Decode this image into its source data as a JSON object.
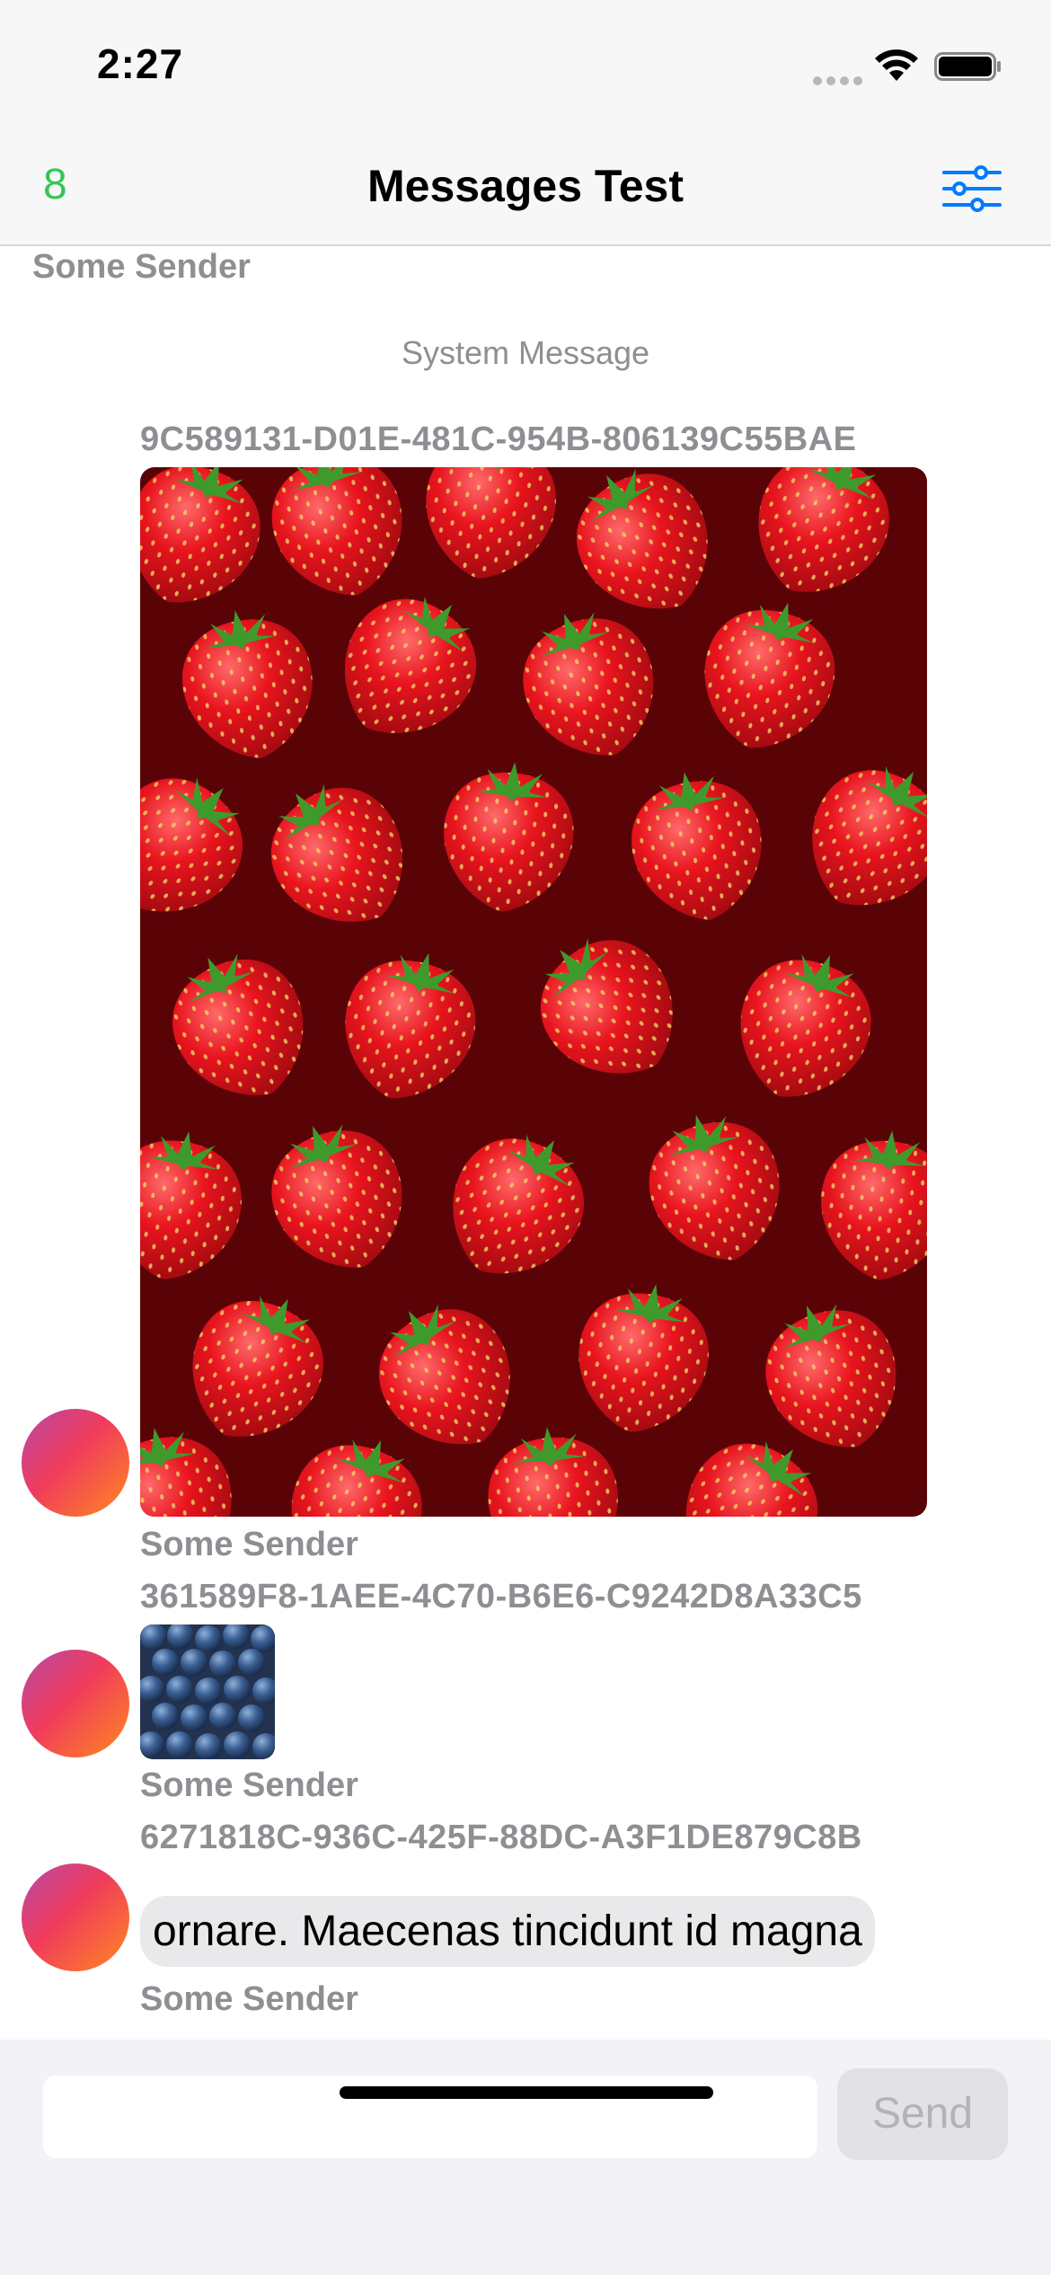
{
  "status_bar": {
    "time": "2:27"
  },
  "nav": {
    "count": "8",
    "title": "Messages Test"
  },
  "messages": {
    "top_sender": "Some Sender",
    "system_message": "System Message",
    "m1": {
      "id": "9C589131-D01E-481C-954B-806139C55BAE",
      "sender": "Some Sender",
      "image": "strawberries"
    },
    "m2": {
      "id": "361589F8-1AEE-4C70-B6E6-C9242D8A33C5",
      "sender": "Some Sender",
      "image": "blueberries"
    },
    "m3": {
      "id": "6271818C-936C-425F-88DC-A3F1DE879C8B",
      "text": "ornare. Maecenas tincidunt id magna",
      "sender": "Some Sender"
    }
  },
  "composer": {
    "placeholder": "",
    "send_label": "Send"
  },
  "colors": {
    "accent": "#007aff",
    "count_green": "#34c759",
    "bubble": "#e9e9eb"
  }
}
